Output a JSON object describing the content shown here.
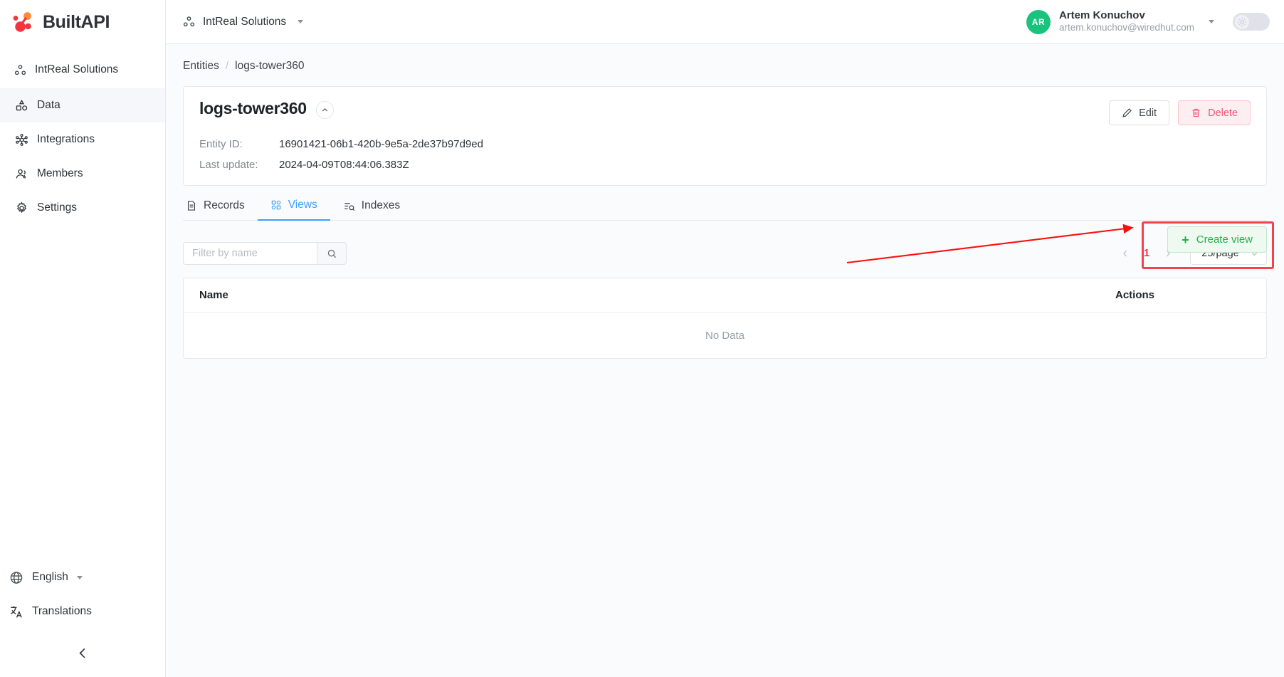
{
  "brand": {
    "name": "BuiltAPI",
    "logo_icon": "builtapi-molecule-logo"
  },
  "sidebar": {
    "org": {
      "label": "IntReal Solutions",
      "icon": "organization-icon"
    },
    "items": [
      {
        "label": "Data",
        "icon": "data-shapes-icon",
        "active": true
      },
      {
        "label": "Integrations",
        "icon": "integrations-network-icon",
        "active": false
      },
      {
        "label": "Members",
        "icon": "members-people-icon",
        "active": false
      },
      {
        "label": "Settings",
        "icon": "gear-icon",
        "active": false
      }
    ],
    "language": {
      "label": "English",
      "icon": "globe-icon",
      "caret": "chevron-down-icon"
    },
    "translations": {
      "label": "Translations",
      "icon": "translate-icon"
    },
    "collapse": {
      "icon": "chevron-left-icon"
    }
  },
  "topbar": {
    "org_switch": {
      "label": "IntReal Solutions",
      "icon": "organization-icon",
      "caret": "chevron-down-icon"
    },
    "user": {
      "initials": "AR",
      "name": "Artem Konuchov",
      "email": "artem.konuchov@wiredhut.com",
      "avatar_color": "#19c37d",
      "caret": "chevron-down-icon"
    },
    "theme_toggle": {
      "icon": "sun-icon",
      "state": "light"
    }
  },
  "breadcrumb": {
    "root": "Entities",
    "separator": "/",
    "current": "logs-tower360"
  },
  "entity": {
    "title": "logs-tower360",
    "collapse_icon": "chevron-up-icon",
    "fields": [
      {
        "label": "Entity ID:",
        "value": "16901421-06b1-420b-9e5a-2de37b97d9ed"
      },
      {
        "label": "Last update:",
        "value": "2024-04-09T08:44:06.383Z"
      }
    ],
    "edit_label": "Edit",
    "edit_icon": "pencil-icon",
    "delete_label": "Delete",
    "delete_icon": "trash-icon"
  },
  "tabs": [
    {
      "label": "Records",
      "icon": "document-icon",
      "active": false
    },
    {
      "label": "Views",
      "icon": "grid-icon",
      "active": true
    },
    {
      "label": "Indexes",
      "icon": "list-search-icon",
      "active": false
    }
  ],
  "toolbar": {
    "filter_placeholder": "Filter by name",
    "filter_value": "",
    "search_icon": "search-icon",
    "create_label": "Create view",
    "create_plus": "+"
  },
  "pagination": {
    "prev_icon": "chevron-left-icon",
    "next_icon": "chevron-right-icon",
    "current_page": "1",
    "page_size": "25/page",
    "page_size_caret": "chevron-down-icon"
  },
  "table": {
    "columns": [
      "Name",
      "Actions"
    ],
    "rows": [],
    "empty_text": "No Data"
  },
  "colors": {
    "accent_blue": "#3f9eff",
    "accent_green": "#22b14c",
    "danger_pink": "#f2547a",
    "active_page": "#ff2d55",
    "annotation_red": "#f4414b",
    "avatar_green": "#19c37d"
  }
}
